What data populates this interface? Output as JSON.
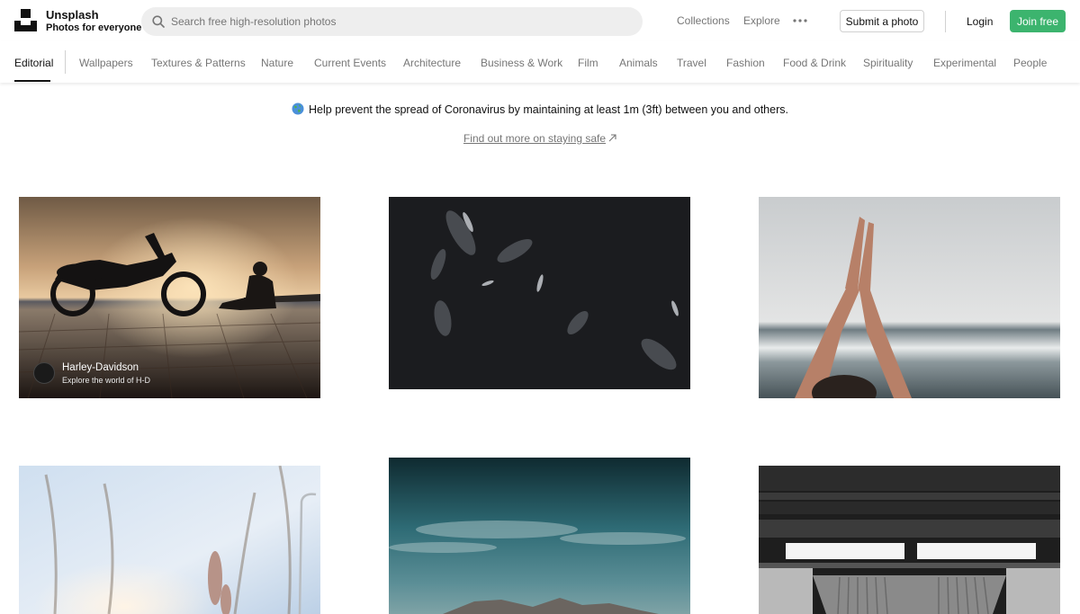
{
  "brand": {
    "name": "Unsplash",
    "tagline": "Photos for everyone"
  },
  "search": {
    "placeholder": "Search free high-resolution photos",
    "value": ""
  },
  "nav": {
    "collections": "Collections",
    "explore": "Explore",
    "submit": "Submit a photo",
    "login": "Login",
    "join": "Join free"
  },
  "tabs": [
    {
      "label": "Editorial",
      "active": true
    },
    {
      "label": "Wallpapers"
    },
    {
      "label": "Textures & Patterns"
    },
    {
      "label": "Nature"
    },
    {
      "label": "Current Events"
    },
    {
      "label": "Architecture"
    },
    {
      "label": "Business & Work"
    },
    {
      "label": "Film"
    },
    {
      "label": "Animals"
    },
    {
      "label": "Travel"
    },
    {
      "label": "Fashion"
    },
    {
      "label": "Food & Drink"
    },
    {
      "label": "Spirituality"
    },
    {
      "label": "Experimental"
    },
    {
      "label": "People"
    }
  ],
  "notice": {
    "text": "Help prevent the spread of Coronavirus by maintaining at least 1m (3ft) between you and others.",
    "link": "Find out more on staying safe"
  },
  "sponsor": {
    "name": "Harley-Davidson",
    "subtitle": "Explore the world of H-D"
  },
  "colors": {
    "accent": "#3cb46e",
    "muted_text": "#767676",
    "search_bg": "#eeeeee"
  }
}
